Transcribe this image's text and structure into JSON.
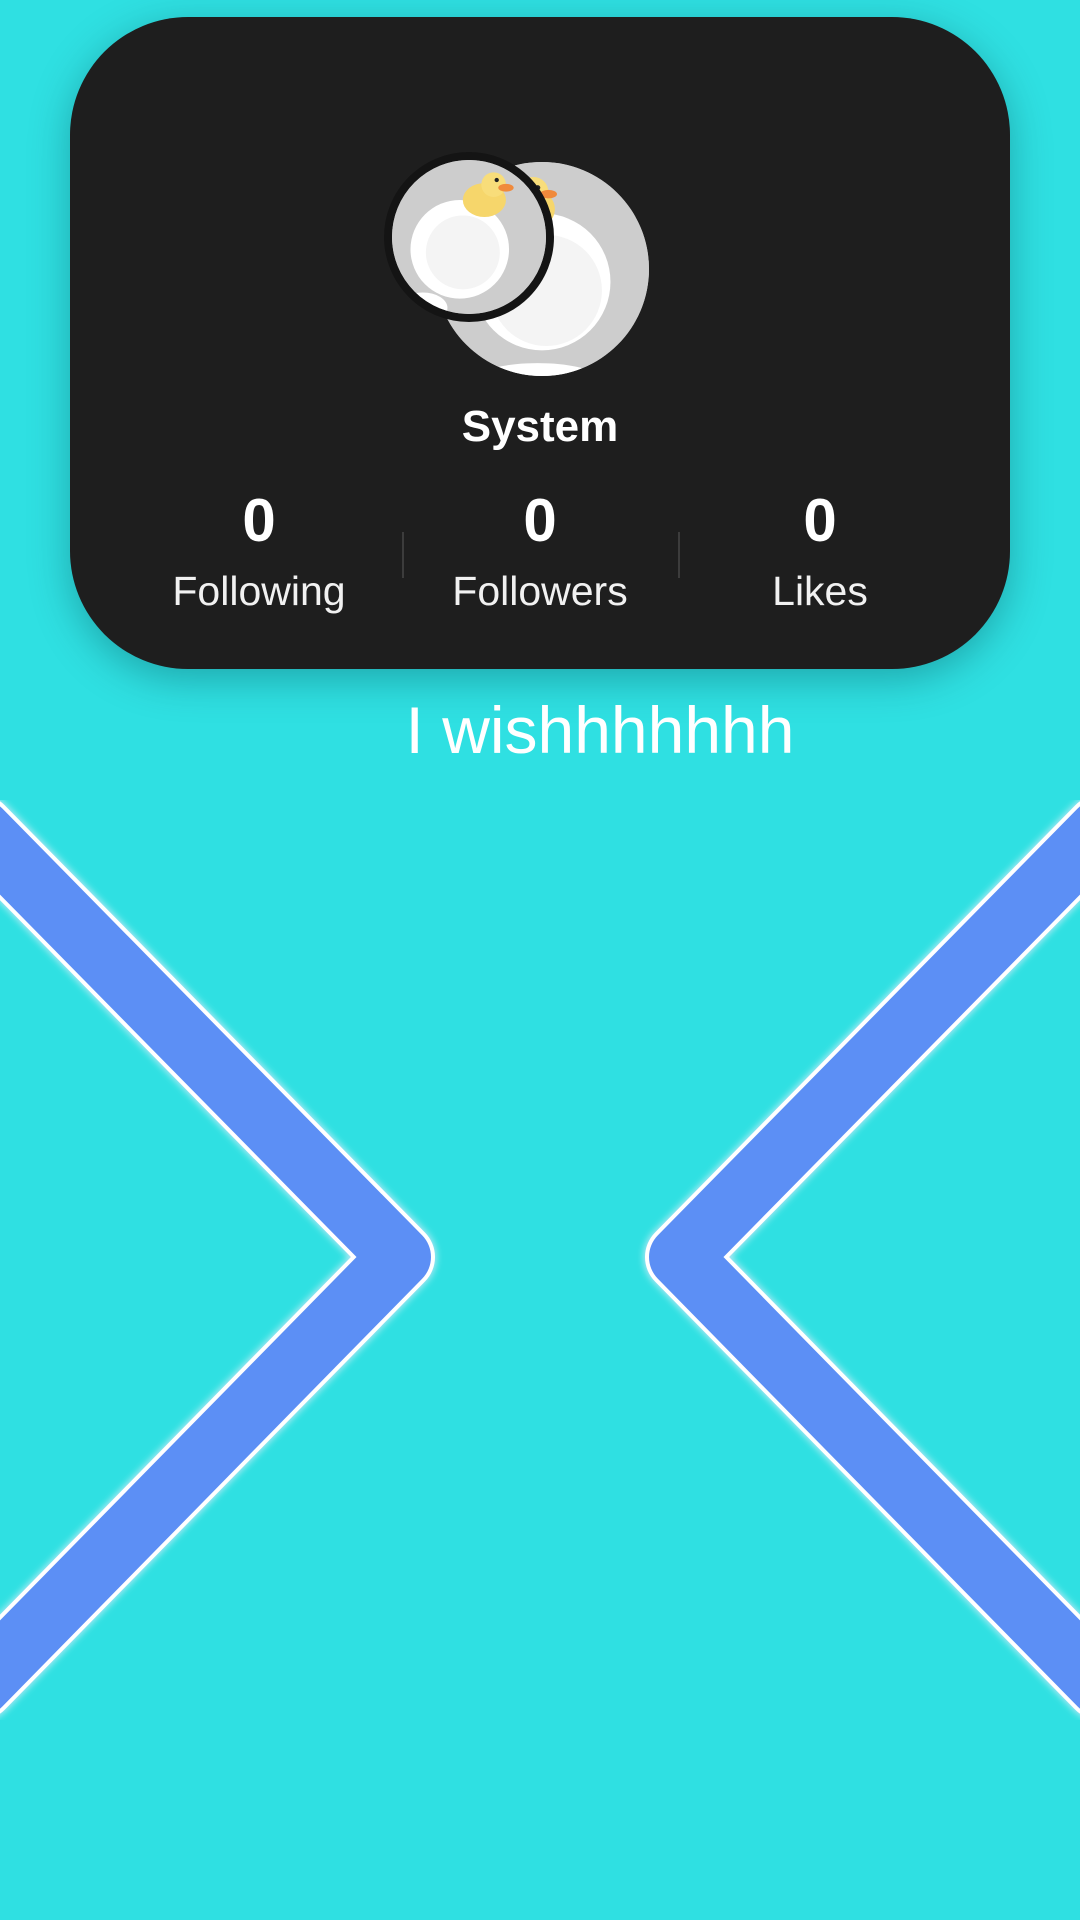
{
  "profile": {
    "username": "System",
    "stats": [
      {
        "count": "0",
        "label": "Following"
      },
      {
        "count": "0",
        "label": "Followers"
      },
      {
        "count": "0",
        "label": "Likes"
      }
    ]
  },
  "caption": "I wishhhhhhh",
  "colors": {
    "background": "#2fe0e2",
    "card": "#1e1e1e",
    "chevron": "#5b8ff5",
    "chevron_outline": "#ffffff"
  },
  "icons": {
    "avatar": "duck-avatar-icon",
    "decor": "chevron-pair-icon"
  }
}
